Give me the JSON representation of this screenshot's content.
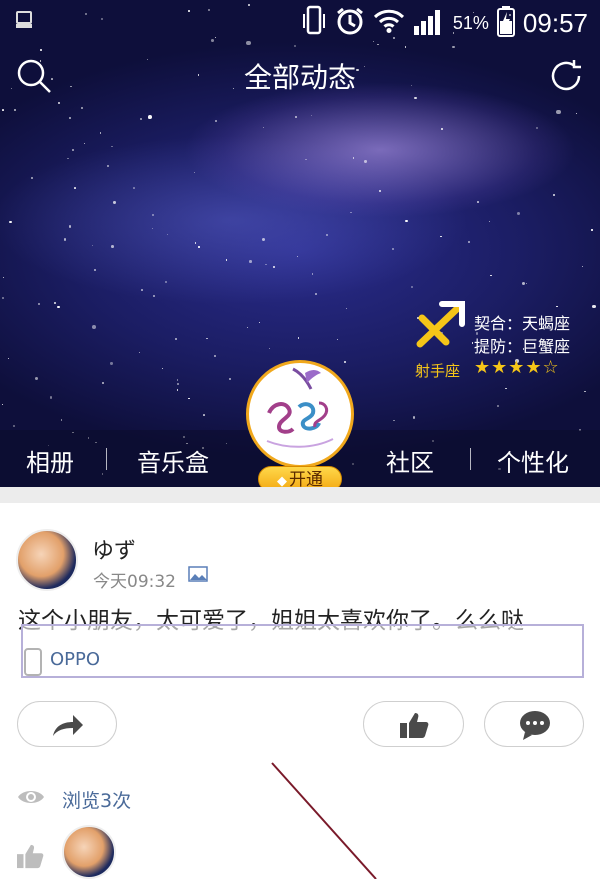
{
  "status_bar": {
    "battery_percent": "51%",
    "time": "09:57"
  },
  "header": {
    "title": "全部动态",
    "left_icon": "search-icon",
    "right_icon": "refresh-icon"
  },
  "zodiac": {
    "match_label": "契合：天蝎座",
    "defend_label": "提防：巨蟹座",
    "sign": "射手座",
    "stars": "★★★★☆",
    "rating": 4,
    "rating_max": 5
  },
  "tabs": [
    "相册",
    "音乐盒",
    "社区",
    "个性化"
  ],
  "badge": {
    "open_label": "开通"
  },
  "post": {
    "username": "ゆず",
    "time": "今天09:32",
    "content": "这个小朋友，太可爱了，姐姐太喜欢你了。么么哒",
    "device": "OPPO",
    "views": "浏览3次"
  },
  "colors": {
    "accent_gold": "#f5c518",
    "link_blue": "#4a6a99"
  }
}
